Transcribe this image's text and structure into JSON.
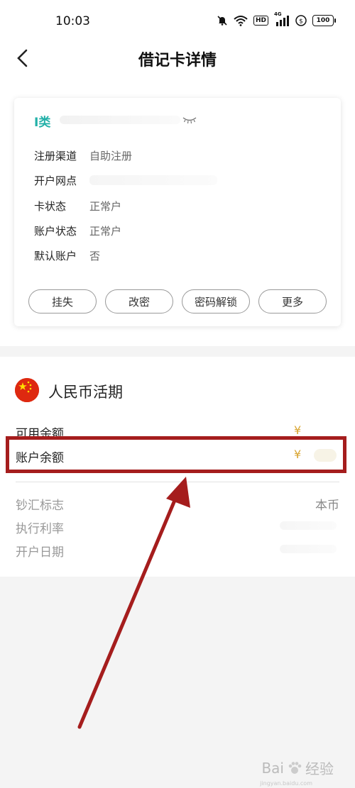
{
  "status_bar": {
    "time": "10:03",
    "network_label": "4G",
    "hd_label": "HD",
    "battery": "100"
  },
  "header": {
    "title": "借记卡详情"
  },
  "card": {
    "type_label": "I类",
    "fields": [
      {
        "label": "注册渠道",
        "value": "自助注册"
      },
      {
        "label": "开户网点",
        "value": ""
      },
      {
        "label": "卡状态",
        "value": "正常户"
      },
      {
        "label": "账户状态",
        "value": "正常户"
      },
      {
        "label": "默认账户",
        "value": "否"
      }
    ],
    "actions": [
      "挂失",
      "改密",
      "密码解锁",
      "更多"
    ]
  },
  "account": {
    "title": "人民币活期",
    "available_balance_label": "可用余额",
    "account_balance_label": "账户余额",
    "currency_symbol": "¥",
    "cash_flag_label": "钞汇标志",
    "cash_flag_value": "本币",
    "rate_label": "执行利率",
    "open_date_label": "开户日期"
  },
  "annotation": {
    "highlight_color": "#a51d1d"
  },
  "watermark": {
    "brand": "Bai",
    "brand_suffix": "经验",
    "url": "jingyan.baidu.com"
  }
}
